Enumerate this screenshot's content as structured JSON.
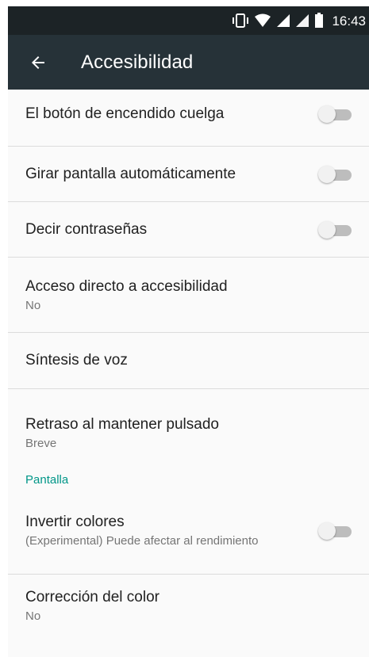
{
  "status_bar": {
    "time": "16:43",
    "icons": [
      "vibrate-icon",
      "wifi-icon",
      "signal-icon",
      "signal-icon",
      "battery-icon"
    ]
  },
  "toolbar": {
    "back_icon": "back-arrow-icon",
    "title": "Accesibilidad"
  },
  "settings": {
    "power_button": {
      "title": "El botón de encendido cuelga",
      "toggle": "off"
    },
    "auto_rotate": {
      "title": "Girar pantalla automáticamente",
      "toggle": "off"
    },
    "speak_passwords": {
      "title": "Decir contraseñas",
      "toggle": "off"
    },
    "accessibility_shortcut": {
      "title": "Acceso directo a accesibilidad",
      "summary": "No"
    },
    "tts": {
      "title": "Síntesis de voz"
    },
    "touch_delay": {
      "title": "Retraso al mantener pulsado",
      "summary": "Breve"
    }
  },
  "display_section": {
    "header": "Pantalla",
    "invert_colors": {
      "title": "Invertir colores",
      "summary": "(Experimental) Puede afectar al rendimiento",
      "toggle": "off"
    },
    "color_correction": {
      "title": "Corrección del color",
      "summary": "No"
    }
  },
  "colors": {
    "status_bar": "#1c2326",
    "toolbar": "#263238",
    "accent": "#009688",
    "background": "#fafafa"
  }
}
